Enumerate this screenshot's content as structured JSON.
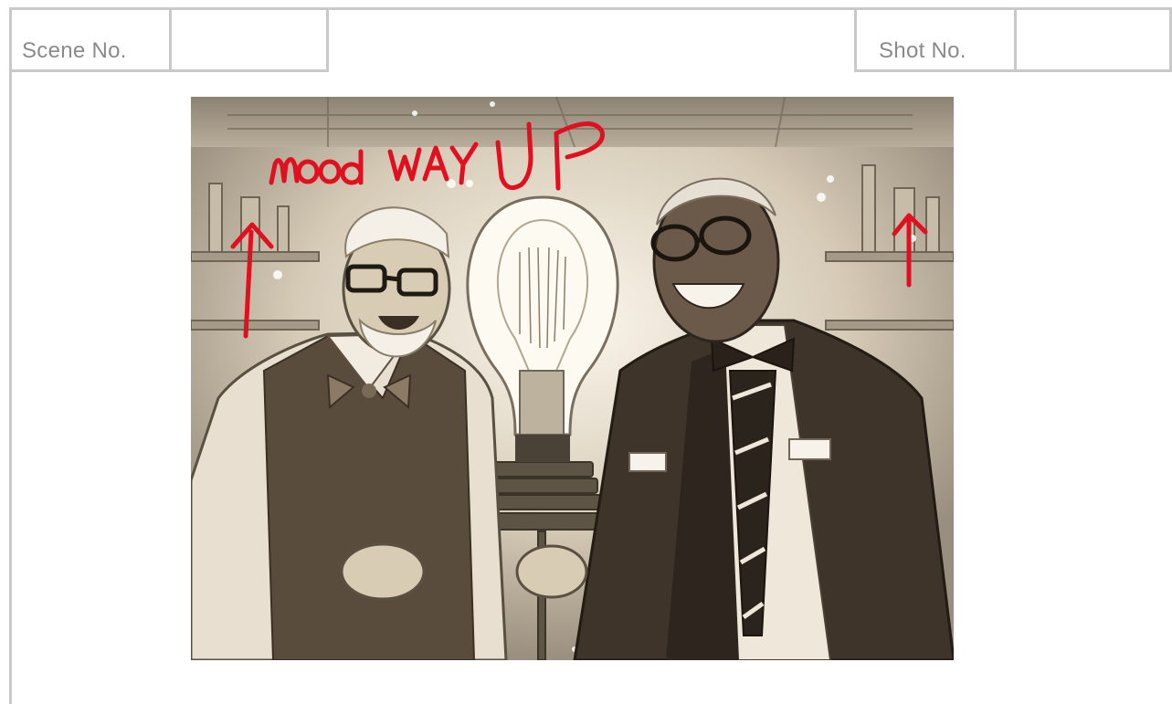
{
  "header": {
    "scene_label": "Scene No.",
    "scene_value": "",
    "shot_label": "Shot No.",
    "shot_value": ""
  },
  "panel": {
    "annotation": "mood WAY UP",
    "annotation_color": "#e01020",
    "illustration": "sepia illustration of two smiling men with glasses and bow ties beside a giant light bulb in a laboratory"
  }
}
